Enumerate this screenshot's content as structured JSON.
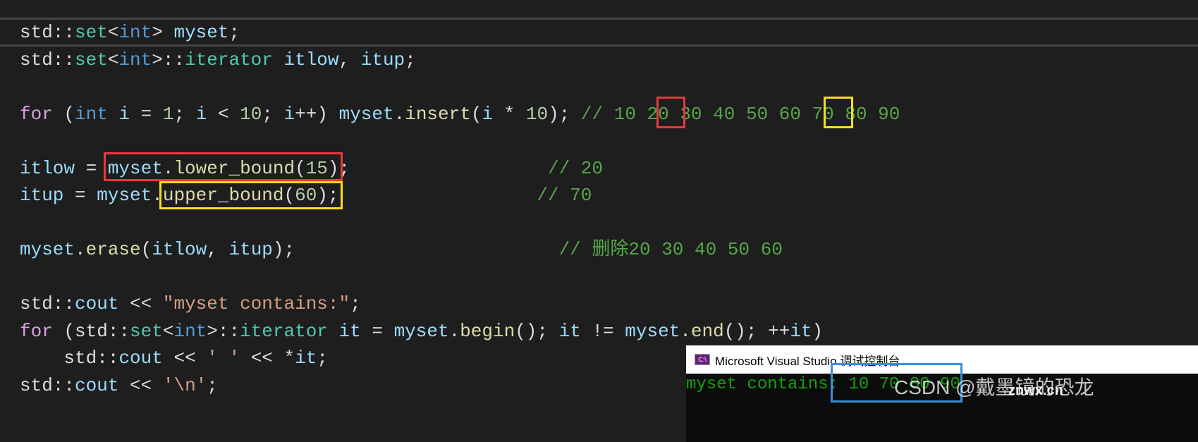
{
  "editor": {
    "lines": [
      [
        [
          "std::",
          "plain"
        ],
        [
          "set",
          "type"
        ],
        [
          "<",
          "plain"
        ],
        [
          "int",
          "kw"
        ],
        [
          "> ",
          "plain"
        ],
        [
          "myset",
          "var"
        ],
        [
          ";",
          "plain"
        ]
      ],
      [
        [
          "std::",
          "plain"
        ],
        [
          "set",
          "type"
        ],
        [
          "<",
          "plain"
        ],
        [
          "int",
          "kw"
        ],
        [
          ">::",
          "plain"
        ],
        [
          "iterator",
          "type"
        ],
        [
          " ",
          "plain"
        ],
        [
          "itlow",
          "var"
        ],
        [
          ", ",
          "plain"
        ],
        [
          "itup",
          "var"
        ],
        [
          ";",
          "plain"
        ]
      ],
      [],
      [
        [
          "for",
          "ctrl"
        ],
        [
          " (",
          "plain"
        ],
        [
          "int",
          "kw"
        ],
        [
          " ",
          "plain"
        ],
        [
          "i",
          "var"
        ],
        [
          " = ",
          "plain"
        ],
        [
          "1",
          "num"
        ],
        [
          "; ",
          "plain"
        ],
        [
          "i",
          "var"
        ],
        [
          " < ",
          "plain"
        ],
        [
          "10",
          "num"
        ],
        [
          "; ",
          "plain"
        ],
        [
          "i",
          "var"
        ],
        [
          "++) ",
          "plain"
        ],
        [
          "myset",
          "var"
        ],
        [
          ".",
          "plain"
        ],
        [
          "insert",
          "fn"
        ],
        [
          "(",
          "plain"
        ],
        [
          "i",
          "var"
        ],
        [
          " * ",
          "plain"
        ],
        [
          "10",
          "num"
        ],
        [
          "); ",
          "plain"
        ],
        [
          "// 10 20 30 40 50 60 70 80 90",
          "cmt"
        ]
      ],
      [],
      [
        [
          "itlow",
          "var"
        ],
        [
          " = ",
          "plain"
        ],
        [
          "myset",
          "var"
        ],
        [
          ".",
          "plain"
        ],
        [
          "lower_bound",
          "fn"
        ],
        [
          "(",
          "plain"
        ],
        [
          "15",
          "num"
        ],
        [
          ");                  ",
          "plain"
        ],
        [
          "// 20",
          "cmt"
        ]
      ],
      [
        [
          "itup",
          "var"
        ],
        [
          " = ",
          "plain"
        ],
        [
          "myset",
          "var"
        ],
        [
          ".",
          "plain"
        ],
        [
          "upper_bound",
          "fn"
        ],
        [
          "(",
          "plain"
        ],
        [
          "60",
          "num"
        ],
        [
          ");                  ",
          "plain"
        ],
        [
          "// 70",
          "cmt"
        ]
      ],
      [],
      [
        [
          "myset",
          "var"
        ],
        [
          ".",
          "plain"
        ],
        [
          "erase",
          "fn"
        ],
        [
          "(",
          "plain"
        ],
        [
          "itlow",
          "var"
        ],
        [
          ", ",
          "plain"
        ],
        [
          "itup",
          "var"
        ],
        [
          ");                        ",
          "plain"
        ],
        [
          "// 删除20 30 40 50 60",
          "cmt"
        ]
      ],
      [],
      [
        [
          "std::",
          "plain"
        ],
        [
          "cout",
          "var"
        ],
        [
          " << ",
          "plain"
        ],
        [
          "\"myset contains:\"",
          "str"
        ],
        [
          ";",
          "plain"
        ]
      ],
      [
        [
          "for",
          "ctrl"
        ],
        [
          " (",
          "plain"
        ],
        [
          "std::",
          "plain"
        ],
        [
          "set",
          "type"
        ],
        [
          "<",
          "plain"
        ],
        [
          "int",
          "kw"
        ],
        [
          ">::",
          "plain"
        ],
        [
          "iterator",
          "type"
        ],
        [
          " ",
          "plain"
        ],
        [
          "it",
          "var"
        ],
        [
          " = ",
          "plain"
        ],
        [
          "myset",
          "var"
        ],
        [
          ".",
          "plain"
        ],
        [
          "begin",
          "fn"
        ],
        [
          "(); ",
          "plain"
        ],
        [
          "it",
          "var"
        ],
        [
          " != ",
          "plain"
        ],
        [
          "myset",
          "var"
        ],
        [
          ".",
          "plain"
        ],
        [
          "end",
          "fn"
        ],
        [
          "(); ++",
          "plain"
        ],
        [
          "it",
          "var"
        ],
        [
          ")",
          "plain"
        ]
      ],
      [
        [
          "    std::",
          "plain"
        ],
        [
          "cout",
          "var"
        ],
        [
          " << ",
          "plain"
        ],
        [
          "' '",
          "str"
        ],
        [
          " << *",
          "plain"
        ],
        [
          "it",
          "var"
        ],
        [
          ";",
          "plain"
        ]
      ],
      [
        [
          "std::",
          "plain"
        ],
        [
          "cout",
          "var"
        ],
        [
          " << ",
          "plain"
        ],
        [
          "'\\n'",
          "str"
        ],
        [
          ";",
          "plain"
        ]
      ]
    ]
  },
  "console": {
    "title": "Microsoft Visual Studio 调试控制台",
    "icon": "console-app-icon",
    "icon_text": "C:\\",
    "output": "myset contains: 10 70 80 90"
  },
  "watermark": {
    "text": "CSDN @戴墨镜的恐龙",
    "site": "znwx.cn"
  },
  "colors": {
    "background": "#1e1e1e",
    "highlight_red": "#e8383d",
    "highlight_yellow": "#f2e01c",
    "highlight_blue": "#3a8ed8",
    "console_text": "#13a10e"
  }
}
